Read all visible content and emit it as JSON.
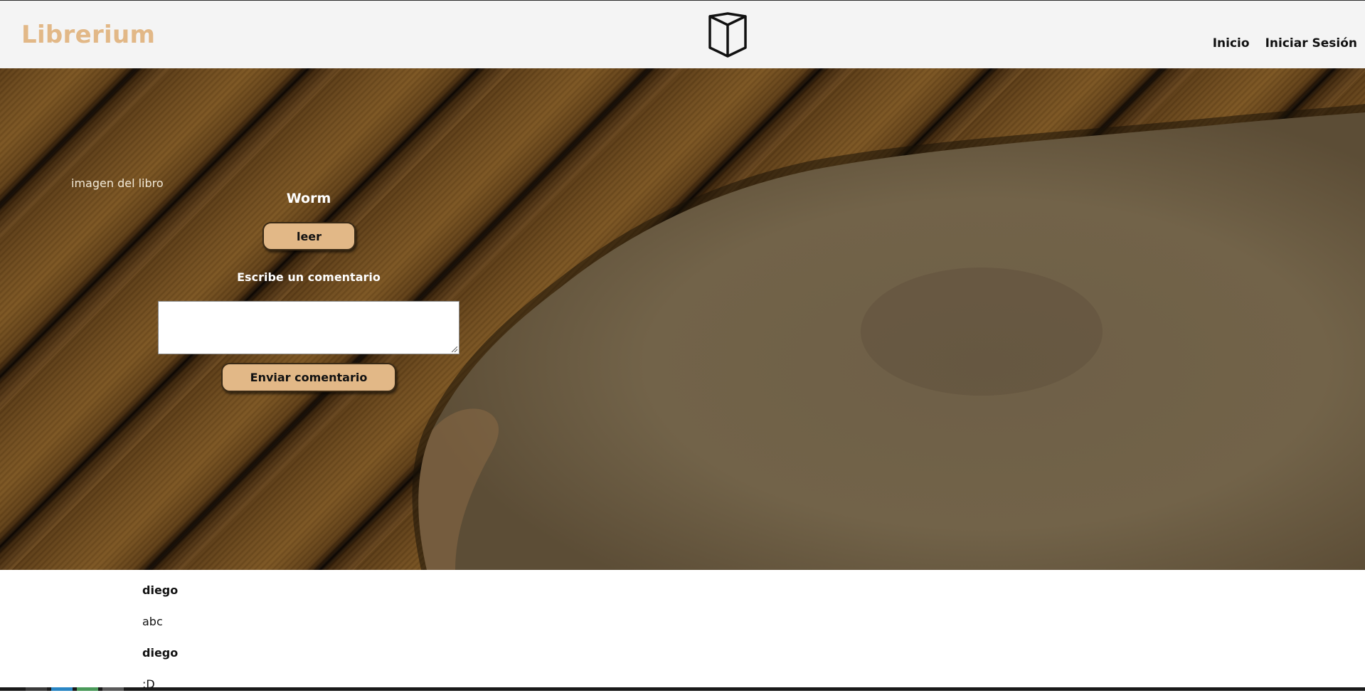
{
  "header": {
    "brand": "Librerium",
    "logo_icon": "open-book-icon",
    "nav": [
      {
        "label": "Inicio"
      },
      {
        "label": "Iniciar Sesión"
      }
    ]
  },
  "book": {
    "image_alt": "imagen del libro",
    "title": "Worm",
    "read_label": "leer",
    "comment_prompt": "Escribe un comentario",
    "comment_value": "",
    "send_label": "Enviar comentario"
  },
  "comments": [
    {
      "author": "diego",
      "text": "abc"
    },
    {
      "author": "diego",
      "text": ":D"
    }
  ],
  "colors": {
    "accent": "#e2b887",
    "header_bg": "#f4f4f4",
    "wood_dark": "#3d250c",
    "parchment": "#7a6a4e"
  }
}
